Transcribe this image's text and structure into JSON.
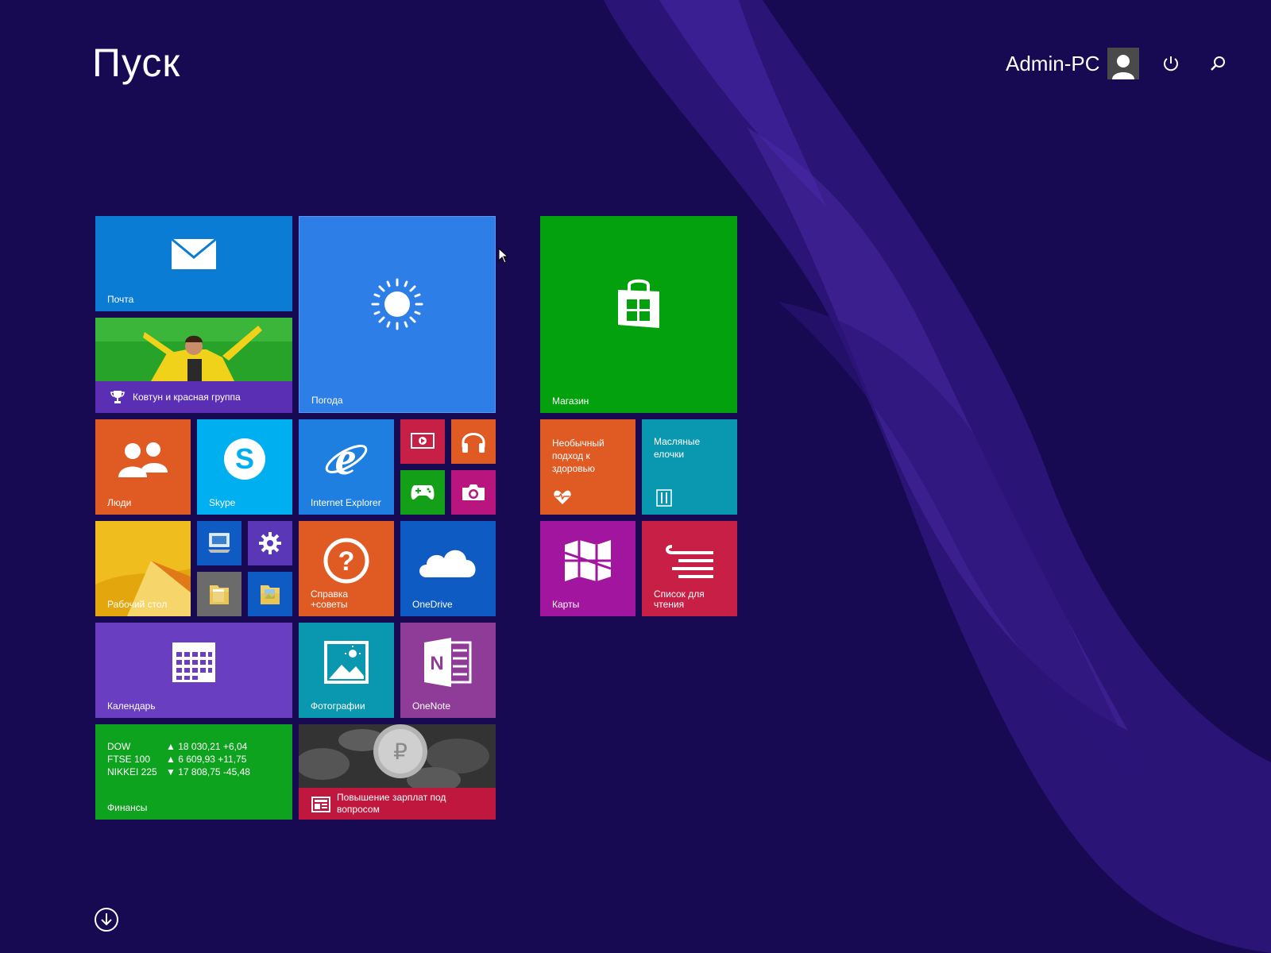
{
  "start": {
    "title": "Пуск"
  },
  "user": {
    "name": "Admin-PC"
  },
  "icons": {
    "power": "power-icon",
    "search": "search-icon",
    "all_apps": "arrow-down-circle-icon"
  },
  "colors": {
    "background": "#180a52",
    "mail": "#0a7cd4",
    "weather": "#2d7ee6",
    "store": "#03a10d",
    "people": "#e05a24",
    "skype": "#00aff0",
    "ie": "#1f7fe0",
    "video": "#c71f45",
    "music": "#e05a24",
    "games": "#13a018",
    "camera": "#b8157f",
    "health": "#e05a24",
    "food": "#0a98b0",
    "maps": "#a2159f",
    "reading": "#c71f45",
    "desktop": "#e8b010",
    "help": "#e05a24",
    "onedrive": "#0f5bc4",
    "calendar": "#6a3ec0",
    "photos": "#0a98b0",
    "onenote": "#8e3c97",
    "finance": "#0ea31e",
    "news_bar": "#c0173e",
    "sport_bar": "#5b2fb3"
  },
  "tiles": {
    "mail": "Почта",
    "sport": "Ковтун и красная группа",
    "weather": "Погода",
    "store": "Магазин",
    "people": "Люди",
    "skype": "Skype",
    "ie": "Internet Explorer",
    "health": "Необычный подход к здоровью",
    "food": "Масляные елочки",
    "desktop": "Рабочий стол",
    "help": "Справка +советы",
    "onedrive": "OneDrive",
    "maps": "Карты",
    "reading": "Список для чтения",
    "calendar": "Календарь",
    "photos": "Фотографии",
    "onenote": "OneNote",
    "finance": "Финансы",
    "news": "Повышение зарплат под вопросом"
  },
  "finance": {
    "rows": [
      {
        "name": "DOW",
        "value": "▲ 18 030,21 +6,04"
      },
      {
        "name": "FTSE 100",
        "value": "▲ 6 609,93 +11,75"
      },
      {
        "name": "NIKKEI 225",
        "value": "▼ 17 808,75 -45,48"
      }
    ]
  }
}
